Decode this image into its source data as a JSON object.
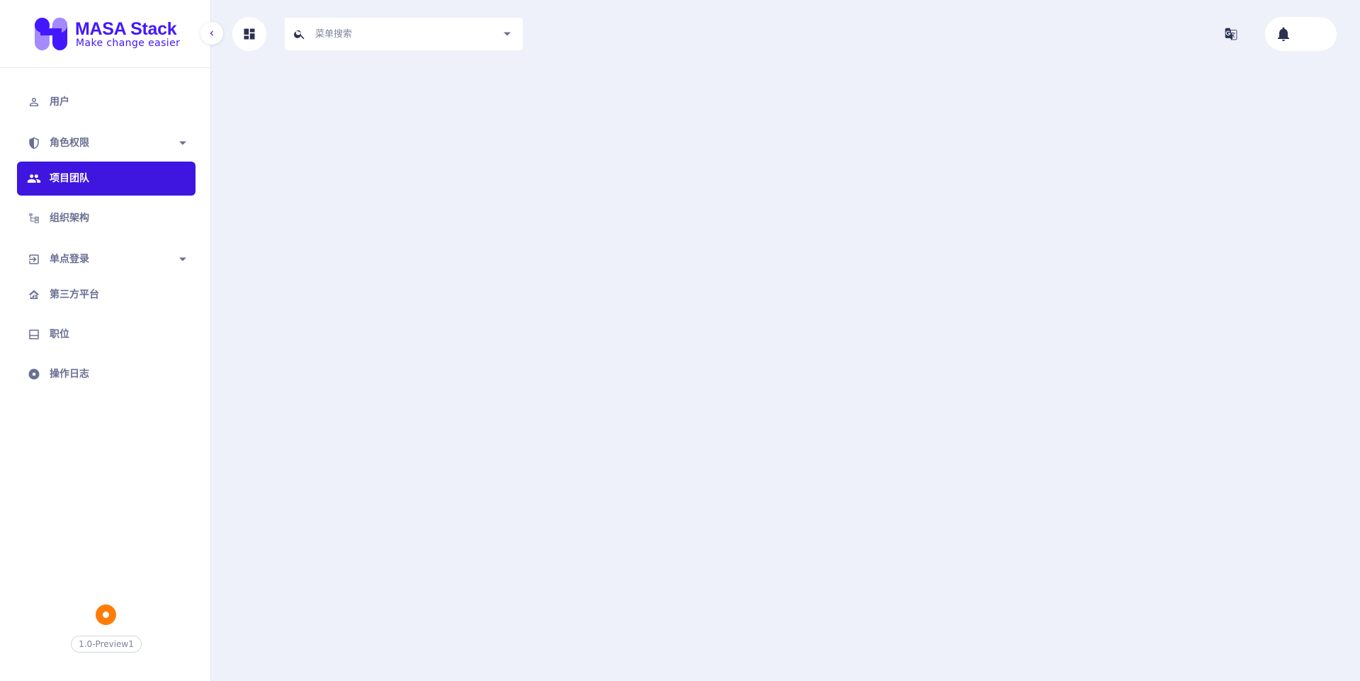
{
  "brand": {
    "title": "MASA Stack",
    "subtitle": "Make change easier",
    "title_color": "#4318FF",
    "subtitle_color": "#4318FF",
    "logo_icon": "masa-logo-icon"
  },
  "colors": {
    "accent": "#3E16E0",
    "background": "#EEF1F9",
    "nav_text": "#6A7093",
    "status_dot": "#FF7D06"
  },
  "sidebar": {
    "collapse_icon": "chevron-left-icon",
    "items": [
      {
        "label": "用户",
        "icon": "user-outline-icon",
        "expandable": false,
        "active": false
      },
      {
        "label": "角色权限",
        "icon": "shield-half-icon",
        "expandable": true,
        "active": false
      },
      {
        "label": "项目团队",
        "icon": "group-icon",
        "expandable": false,
        "active": true
      },
      {
        "label": "组织架构",
        "icon": "org-tree-icon",
        "expandable": false,
        "active": false
      },
      {
        "label": "单点登录",
        "icon": "login-icon",
        "expandable": true,
        "active": false
      },
      {
        "label": "第三方平台",
        "icon": "home-share-icon",
        "expandable": false,
        "active": false
      },
      {
        "label": "职位",
        "icon": "position-icon",
        "expandable": false,
        "active": false
      },
      {
        "label": "操作日志",
        "icon": "record-circle-icon",
        "expandable": false,
        "active": false
      }
    ],
    "version": "1.0-Preview1"
  },
  "topbar": {
    "dashboard_icon": "dashboard-icon",
    "search": {
      "placeholder": "菜单搜索",
      "value": "",
      "icon": "search-icon",
      "dropdown_icon": "caret-down-icon"
    },
    "translate_icon": "translate-icon",
    "notification_icon": "bell-icon"
  }
}
